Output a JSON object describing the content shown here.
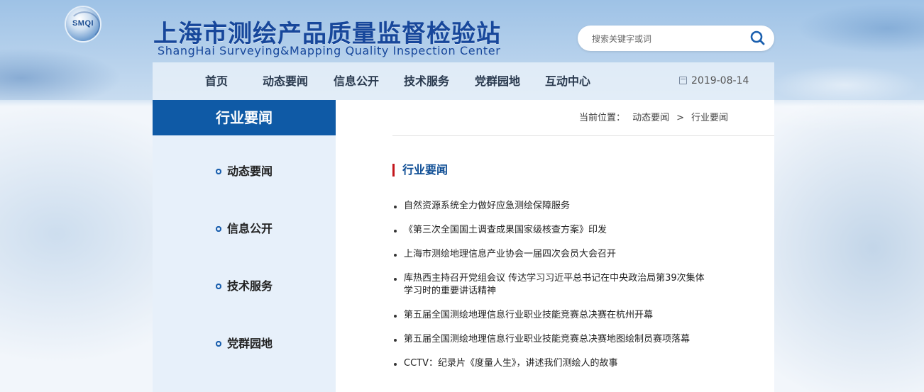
{
  "header": {
    "logo_text": "SMQI",
    "title": "上海市测绘产品质量监督检验站",
    "subtitle": "ShangHai Surveying&Mapping Quality Inspection Center",
    "search_placeholder": "搜索关键字或词"
  },
  "nav": {
    "items": [
      {
        "label": "首页"
      },
      {
        "label": "动态要闻"
      },
      {
        "label": "信息公开"
      },
      {
        "label": "技术服务"
      },
      {
        "label": "党群园地"
      },
      {
        "label": "互动中心"
      }
    ],
    "date": "2019-08-14"
  },
  "sidebar": {
    "title": "行业要闻",
    "items": [
      {
        "label": "动态要闻"
      },
      {
        "label": "信息公开"
      },
      {
        "label": "技术服务"
      },
      {
        "label": "党群园地"
      }
    ]
  },
  "breadcrumb": {
    "prefix": "当前位置：",
    "items": [
      "动态要闻",
      "行业要闻"
    ],
    "separator": ">"
  },
  "main": {
    "section_title": "行业要闻",
    "news": [
      {
        "title": "自然资源系统全力做好应急测绘保障服务"
      },
      {
        "title": "《第三次全国国土调查成果国家级核查方案》印发"
      },
      {
        "title": "上海市测绘地理信息产业协会一届四次会员大会召开"
      },
      {
        "title": "库热西主持召开党组会议 传达学习习近平总书记在中央政治局第39次集体学习时的重要讲话精神"
      },
      {
        "title": "第五届全国测绘地理信息行业职业技能竞赛总决赛在杭州开幕"
      },
      {
        "title": "第五届全国测绘地理信息行业职业技能竞赛总决赛地图绘制员赛项落幕"
      },
      {
        "title": "CCTV：纪录片《度量人生》，讲述我们测绘人的故事"
      }
    ]
  },
  "colors": {
    "primary_blue": "#0f5aa6",
    "title_blue": "#17479b",
    "accent_red": "#c3161c",
    "sidebar_bg": "#e7f0fa"
  }
}
